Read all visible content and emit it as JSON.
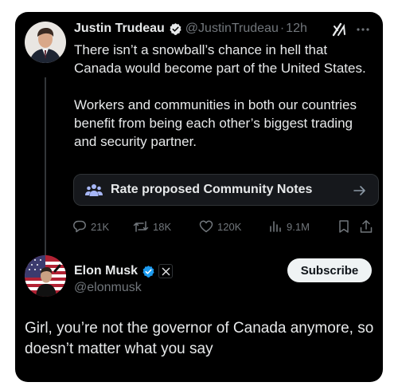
{
  "tweet": {
    "author_name": "Justin Trudeau",
    "handle": "@JustinTrudeau",
    "separator": "·",
    "time": "12h",
    "paragraphs": [
      "There isn’t a snowball’s chance in hell that Canada would become part of the United States.",
      "Workers and communities in both our countries benefit from being each other’s biggest trading and security partner."
    ],
    "community_notes_label": "Rate proposed Community Notes",
    "replies": "21K",
    "reposts": "18K",
    "likes": "120K",
    "views": "9.1M",
    "icons": [
      "verified-badge-icon",
      "grok-icon",
      "more-icon",
      "community-notes-icon",
      "arrow-right-icon",
      "reply-icon",
      "repost-icon",
      "like-icon",
      "views-icon",
      "bookmark-icon",
      "share-icon"
    ]
  },
  "reply": {
    "author_name": "Elon Musk",
    "handle": "@elonmusk",
    "subscribe_label": "Subscribe",
    "text": "Girl, you’re not the governor of Canada anymore, so doesn’t matter what you say",
    "icons": [
      "verified-badge-icon",
      "x-affiliate-icon"
    ]
  },
  "colors": {
    "background": "#000000",
    "text": "#e7e9ea",
    "muted": "#71767b",
    "verified": "#1d9bf0",
    "notes_accent": "#a7b7f7"
  }
}
